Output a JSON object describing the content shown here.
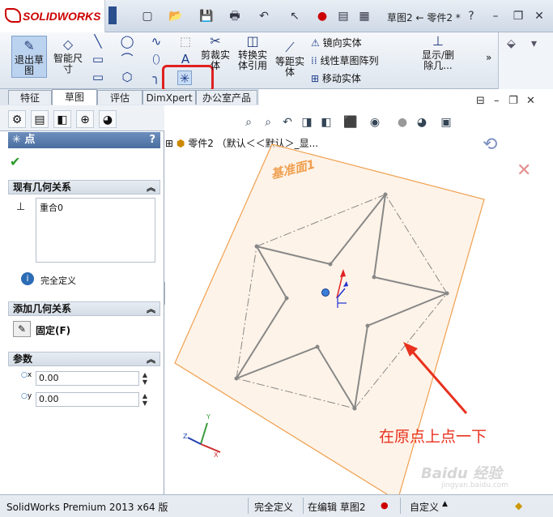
{
  "app": {
    "logo_text": "SOLIDWORKS",
    "document_title": "草图2 ← 零件2 *",
    "help_glyph": "?"
  },
  "ribbon": {
    "buttons": [
      {
        "label": "退出草\n图",
        "icon": "exit-sketch-icon"
      },
      {
        "label": "智能尺\n寸",
        "icon": "smart-dimension-icon"
      },
      {
        "label": "剪裁实\n体",
        "icon": "trim-entities-icon"
      },
      {
        "label": "转换实\n体引用",
        "icon": "convert-entities-icon"
      },
      {
        "label": "等距实\n体",
        "icon": "offset-entities-icon"
      },
      {
        "label": "显示/删\n除几...",
        "icon": "display-delete-relations-icon"
      }
    ],
    "list_items": [
      {
        "label": "镜向实体",
        "icon": "mirror-icon"
      },
      {
        "label": "线性草图阵列",
        "icon": "linear-pattern-icon"
      },
      {
        "label": "移动实体",
        "icon": "move-icon"
      }
    ]
  },
  "command_tabs": [
    "特征",
    "草图",
    "评估",
    "DimXpert",
    "办公室产品"
  ],
  "property_manager": {
    "title": "点",
    "help": "?",
    "existing_relations": {
      "header": "现有几何关系",
      "items": [
        "重合0"
      ],
      "status": "完全定义"
    },
    "add_relations": {
      "header": "添加几何关系",
      "fix_button": "固定(F)"
    },
    "parameters": {
      "header": "参数",
      "x_label": "x",
      "x_value": "0.00",
      "y_label": "y",
      "y_value": "0.00"
    }
  },
  "viewport": {
    "tree_label": "零件2 （默认＜＜默认＞_显...",
    "plane_label": "基准面1",
    "annotation": "在原点上点一下",
    "triad": {
      "x": "X",
      "y": "Y",
      "z": "Z"
    }
  },
  "statusbar": {
    "app_name": "SolidWorks Premium 2013 x64 版",
    "status": "完全定义",
    "editing": "在编辑 草图2",
    "units": "自定义"
  },
  "watermark": {
    "main": "Baidu 经验",
    "sub": "jingyan.baidu.com"
  },
  "colors": {
    "accent_red": "#e8321f",
    "plane_orange": "#f0a050",
    "highlight_red": "#e02020"
  }
}
